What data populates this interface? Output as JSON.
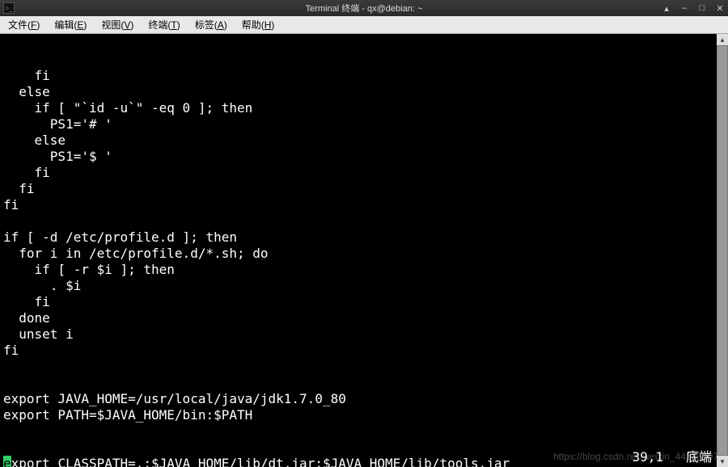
{
  "titlebar": {
    "title": "Terminal 终端 - qx@debian: ~"
  },
  "window_controls": {
    "up": "▴",
    "min": "–",
    "max": "□",
    "close": "✕"
  },
  "menubar": [
    {
      "label": "文件(",
      "key": "F",
      "after": ")"
    },
    {
      "label": "编辑(",
      "key": "E",
      "after": ")"
    },
    {
      "label": "视图(",
      "key": "V",
      "after": ")"
    },
    {
      "label": "终端(",
      "key": "T",
      "after": ")"
    },
    {
      "label": "标签(",
      "key": "A",
      "after": ")"
    },
    {
      "label": "帮助(",
      "key": "H",
      "after": ")"
    }
  ],
  "terminal": {
    "lines": [
      "    fi",
      "  else",
      "    if [ \"`id -u`\" -eq 0 ]; then",
      "      PS1='# '",
      "    else",
      "      PS1='$ '",
      "    fi",
      "  fi",
      "fi",
      "",
      "if [ -d /etc/profile.d ]; then",
      "  for i in /etc/profile.d/*.sh; do",
      "    if [ -r $i ]; then",
      "      . $i",
      "    fi",
      "  done",
      "  unset i",
      "fi",
      "",
      "",
      "export JAVA_HOME=/usr/local/java/jdk1.7.0_80",
      "export PATH=$JAVA_HOME/bin:$PATH"
    ],
    "last_line_cursor_char": "e",
    "last_line_rest": "xport CLASSPATH=.:$JAVA_HOME/lib/dt.jar:$JAVA_HOME/lib/tools.jar",
    "status_pos": "39,1",
    "status_label": "底端"
  },
  "watermark": "https://blog.csdn.net/weixin_44538107"
}
